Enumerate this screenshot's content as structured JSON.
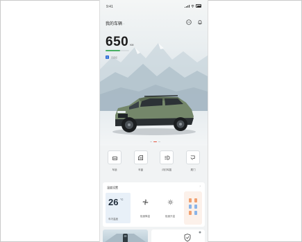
{
  "status_bar": {
    "time": "9:41"
  },
  "header": {
    "title": "我的车辆",
    "title_suffix": "."
  },
  "range": {
    "value": "650",
    "unit": "KM",
    "fill_fraction": 0.62,
    "bar_color": "#48b064"
  },
  "bluetooth": {
    "text": "已连接"
  },
  "pager": {
    "count": 3,
    "active": 1
  },
  "quick_actions": [
    {
      "label": "车锁",
      "icon": "lock-icon"
    },
    {
      "label": "车窗",
      "icon": "window-icon"
    },
    {
      "label": "闪灯鸣笛",
      "icon": "headlight-icon"
    },
    {
      "label": "尾门",
      "icon": "tailgate-icon"
    }
  ],
  "climate": {
    "title": "温度设置",
    "temperature": "26",
    "unit": "°C",
    "temperature_label": "车内温度",
    "modes": [
      {
        "label": "极速降温",
        "icon": "fan-icon"
      },
      {
        "label": "极速升温",
        "icon": "sun-icon"
      }
    ]
  },
  "colors": {
    "accent": "#e5533d",
    "bluetooth": "#2d6cd6"
  }
}
